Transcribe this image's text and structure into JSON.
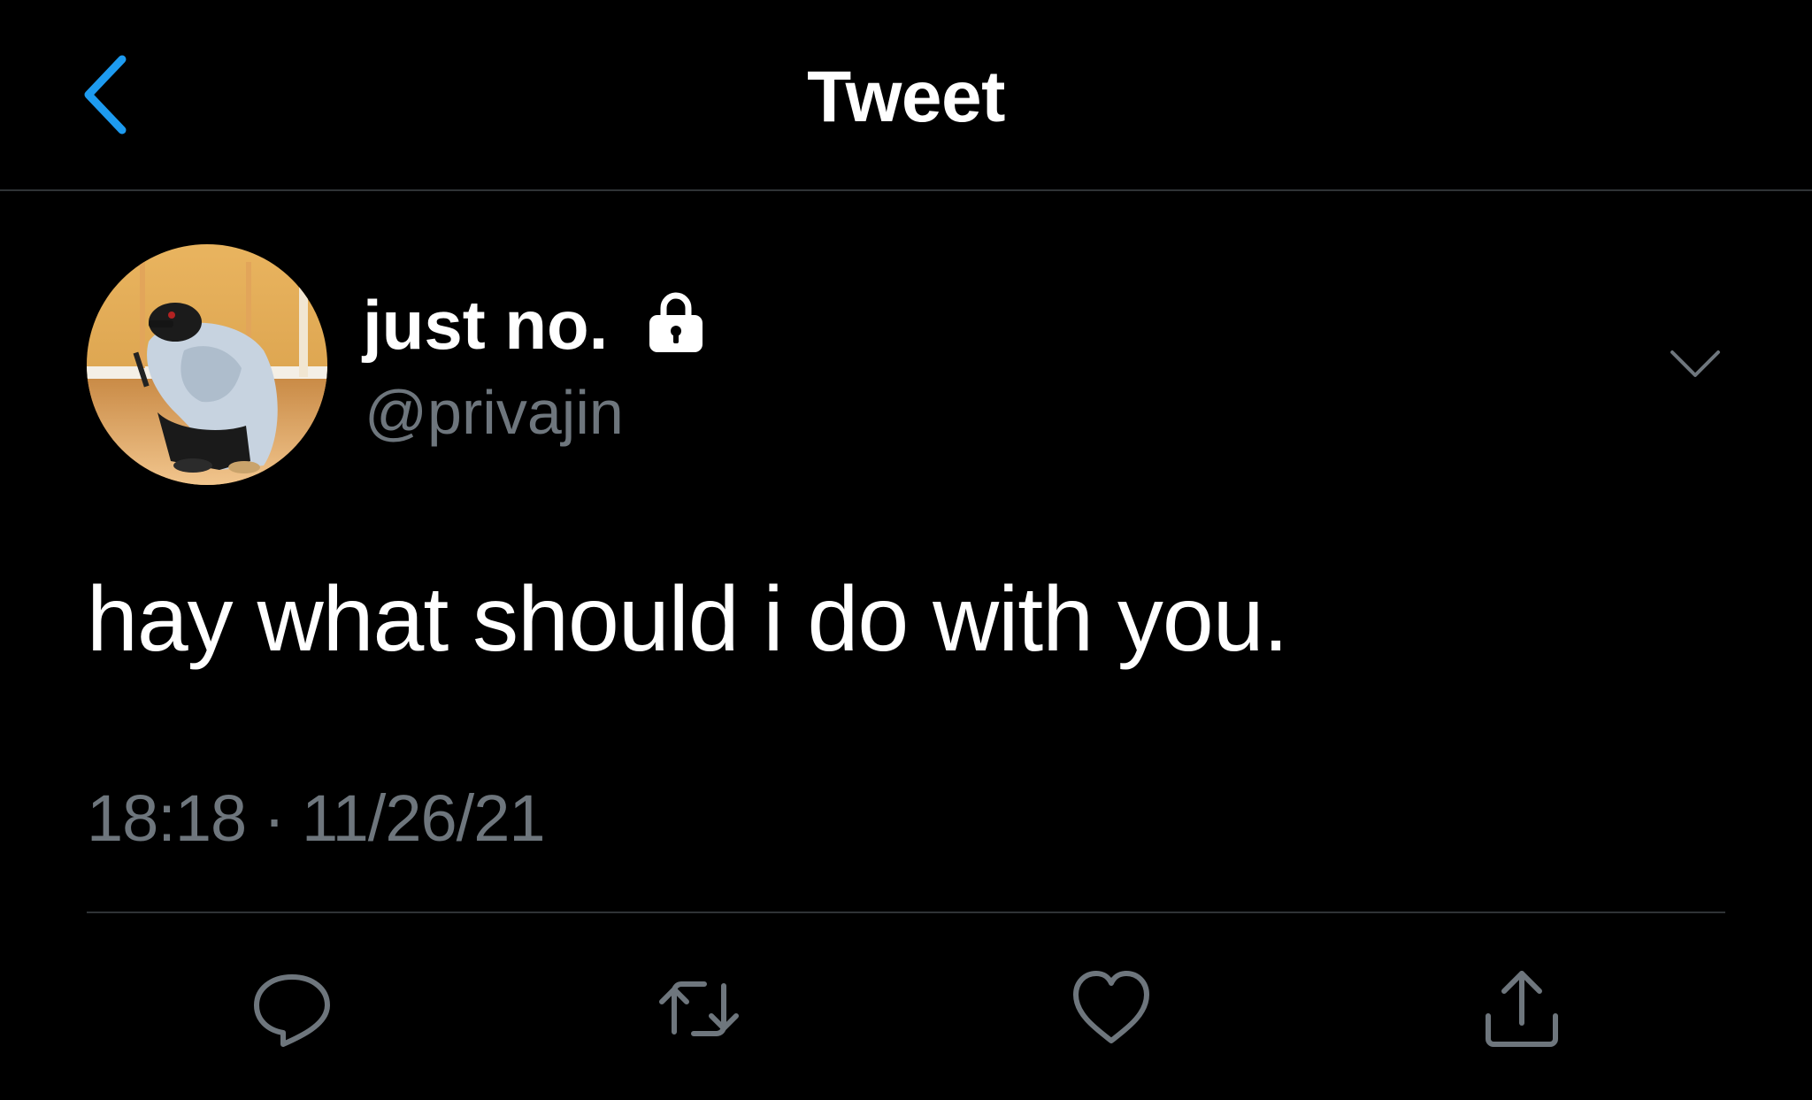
{
  "header": {
    "title": "Tweet",
    "back_icon": "chevron-left-icon",
    "accent_color": "#1d9bf0"
  },
  "author": {
    "display_name": "just no.",
    "handle": "@privajin",
    "protected_icon": "lock-icon"
  },
  "tweet": {
    "text": "hay what should i do with you.",
    "timestamp": "18:18 · 11/26/21"
  },
  "actions": [
    {
      "icon": "reply-icon"
    },
    {
      "icon": "retweet-icon"
    },
    {
      "icon": "like-icon"
    },
    {
      "icon": "share-icon"
    }
  ],
  "colors": {
    "background": "#000000",
    "text": "#ffffff",
    "secondary_text": "#6e767d",
    "divider": "#2f3336"
  }
}
